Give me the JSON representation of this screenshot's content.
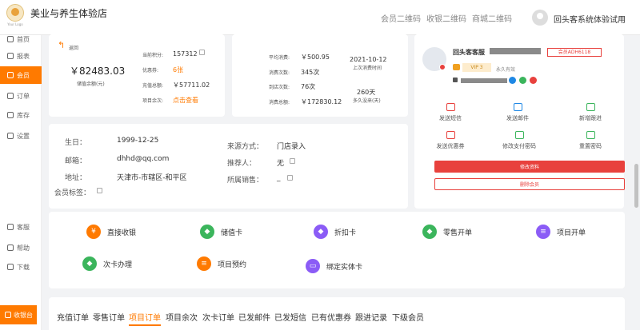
{
  "header": {
    "logo_sub": "Your Logo",
    "store_name": "美业与养生体验店",
    "qr_codes": [
      "会员二维码",
      "收银二维码",
      "商城二维码"
    ],
    "user": "回头客系统体验试用"
  },
  "sidebar": {
    "items": [
      "首页",
      "报表",
      "会员",
      "订单",
      "库存",
      "设置"
    ],
    "bottom": [
      "客服",
      "帮助",
      "下载"
    ],
    "cashier": "收银台"
  },
  "balance": {
    "back": "返回",
    "amount": "￥82483.03",
    "amount_label": "储值余额(元)",
    "points_label": "当前积分:",
    "points": "157312",
    "coupon_label": "优惠券:",
    "coupon": "6张",
    "recharge_label": "充值总额:",
    "recharge": "￥57711.02",
    "items_label": "项目余次:",
    "items_link": "点击查看"
  },
  "stats": {
    "avg_label": "平均消费:",
    "avg": "￥500.95",
    "count_label": "消费次数:",
    "count": "345次",
    "last_date": "2021-10-12",
    "last_label": "上次消费时间",
    "visit_label": "到店次数:",
    "visit": "76次",
    "total_label": "消费总额:",
    "total": "￥172830.12",
    "days": "260天",
    "days_label": "多久没来(天)"
  },
  "member": {
    "name": "回头客客服",
    "card_no": "会员ADH6118",
    "vip": "VIP 3",
    "validity": "永久有效",
    "actions": [
      "发送短信",
      "发送邮件",
      "新增跟进",
      "发送优惠券",
      "修改支付密码",
      "重置密码"
    ],
    "edit_btn": "修改资料",
    "delete_btn": "删除会员"
  },
  "info": {
    "birthday_label": "生日：",
    "birthday": "1999-12-25",
    "email_label": "邮箱：",
    "email": "dhhd@qq.com",
    "address_label": "地址：",
    "address": "天津市-市辖区-和平区",
    "tag_label": "会员标签：",
    "source_label": "来源方式：",
    "source": "门店录入",
    "referrer_label": "推荐人：",
    "referrer": "无",
    "seller_label": "所属销售：",
    "seller": "_"
  },
  "ops": [
    {
      "label": "直接收银",
      "icon": "¥"
    },
    {
      "label": "储值卡",
      "icon": "◆"
    },
    {
      "label": "折扣卡",
      "icon": "◆"
    },
    {
      "label": "零售开单",
      "icon": "◆"
    },
    {
      "label": "项目开单",
      "icon": "≡"
    },
    {
      "label": "次卡办理",
      "icon": "◆"
    },
    {
      "label": "项目预约",
      "icon": "≡"
    },
    {
      "label": "绑定实体卡",
      "icon": "▭"
    }
  ],
  "tabs": [
    "充值订单",
    "零售订单",
    "项目订单",
    "项目余次",
    "次卡订单",
    "已发邮件",
    "已发短信",
    "已有优惠券",
    "跟进记录",
    "下级会员"
  ],
  "colors": {
    "accent": "#ff7a00",
    "danger": "#e8413d",
    "green": "#3bb55c",
    "purple": "#8b5cf6"
  }
}
